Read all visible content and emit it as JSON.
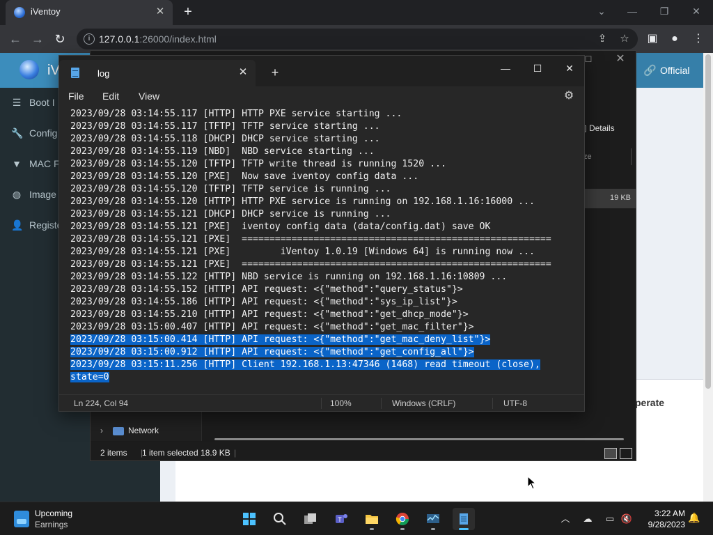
{
  "browser": {
    "tab_title": "iVentoy",
    "url_host": "127.0.0.1",
    "url_rest": ":26000/index.html"
  },
  "page": {
    "brand": "iV",
    "official": "Official",
    "sidebar": [
      {
        "label": "Boot I",
        "icon": "list-icon"
      },
      {
        "label": "Config",
        "icon": "wrench-icon"
      },
      {
        "label": "MAC F",
        "icon": "filter-icon"
      },
      {
        "label": "Image",
        "icon": "globe-icon"
      },
      {
        "label": "Registe",
        "icon": "user-icon"
      }
    ],
    "operate": "perate"
  },
  "explorer": {
    "details": "Details",
    "size_col": "ze",
    "selected_size": "19 KB",
    "network": "Network",
    "status_items": "2 items",
    "status_selected": "1 item selected  18.9 KB"
  },
  "notepad": {
    "tab_title": "log",
    "menu": [
      "File",
      "Edit",
      "View"
    ],
    "lines": [
      "2023/09/28 03:14:55.117 [HTTP] HTTP PXE service starting ...",
      "2023/09/28 03:14:55.117 [TFTP] TFTP service starting ...",
      "2023/09/28 03:14:55.118 [DHCP] DHCP service starting ...",
      "2023/09/28 03:14:55.119 [NBD]  NBD service starting ...",
      "2023/09/28 03:14:55.120 [TFTP] TFTP write thread is running 1520 ...",
      "2023/09/28 03:14:55.120 [PXE]  Now save iventoy config data ...",
      "2023/09/28 03:14:55.120 [TFTP] TFTP service is running ...",
      "2023/09/28 03:14:55.120 [HTTP] HTTP PXE service is running on 192.168.1.16:16000 ...",
      "2023/09/28 03:14:55.121 [DHCP] DHCP service is running ...",
      "2023/09/28 03:14:55.121 [PXE]  iventoy config data (data/config.dat) save OK",
      "2023/09/28 03:14:55.121 [PXE]  ========================================================",
      "2023/09/28 03:14:55.121 [PXE]         iVentoy 1.0.19 [Windows 64] is running now ...",
      "2023/09/28 03:14:55.121 [PXE]  ========================================================",
      "2023/09/28 03:14:55.122 [HTTP] NBD service is running on 192.168.1.16:10809 ...",
      "2023/09/28 03:14:55.152 [HTTP] API request: <{\"method\":\"query_status\"}>",
      "2023/09/28 03:14:55.186 [HTTP] API request: <{\"method\":\"sys_ip_list\"}>",
      "2023/09/28 03:14:55.210 [HTTP] API request: <{\"method\":\"get_dhcp_mode\"}>",
      "2023/09/28 03:15:00.407 [HTTP] API request: <{\"method\":\"get_mac_filter\"}>"
    ],
    "selected_lines": [
      "2023/09/28 03:15:00.414 [HTTP] API request: <{\"method\":\"get_mac_deny_list\"}>",
      "2023/09/28 03:15:00.912 [HTTP] API request: <{\"method\":\"get_config_all\"}>",
      "2023/09/28 03:15:11.256 [HTTP] Client 192.168.1.13:47346 (1468) read timeout (close),",
      "state=0"
    ],
    "status": {
      "position": "Ln 224, Col 94",
      "zoom": "100%",
      "line_ending": "Windows (CRLF)",
      "encoding": "UTF-8"
    }
  },
  "taskbar": {
    "widget_title": "Upcoming",
    "widget_sub": "Earnings",
    "time": "3:22 AM",
    "date": "9/28/2023"
  }
}
